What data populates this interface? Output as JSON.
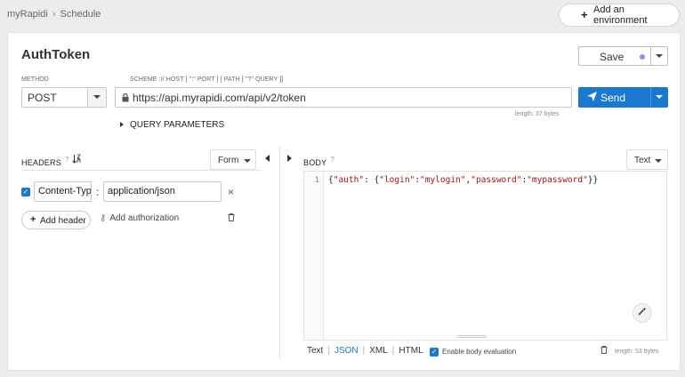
{
  "breadcrumb": {
    "root": "myRapidi",
    "separator": "›",
    "current": "Schedule"
  },
  "env_button": {
    "label": "Add an environment"
  },
  "request": {
    "title": "AuthToken",
    "save_label": "Save",
    "method_label": "METHOD",
    "method_value": "POST",
    "url_label": "SCHEME :// HOST [ \":\" PORT ] [ PATH [ \"?\" QUERY ]]",
    "url_value": "https://api.myrapidi.com/api/v2/token",
    "url_length": "length: 37 bytes",
    "send_label": "Send",
    "query_params_label": "QUERY PARAMETERS"
  },
  "headers": {
    "label": "HEADERS",
    "help": "?",
    "mode": "Form",
    "rows": [
      {
        "enabled": true,
        "name": "Content-Type",
        "value": "application/json"
      }
    ],
    "add_header_label": "Add header",
    "add_auth_label": "Add authorization"
  },
  "body": {
    "label": "BODY",
    "help": "?",
    "mode": "Text",
    "line_number": "1",
    "content": "{\"auth\": {\"login\":\"mylogin\",\"password\":\"mypassword\"}}",
    "formats": [
      "Text",
      "JSON",
      "XML",
      "HTML"
    ],
    "active_format": "JSON",
    "eval_label": "Enable body evaluation",
    "length": "length: 53 bytes"
  },
  "colors": {
    "accent": "#1b78cf",
    "save_dot": "#8e8ee8"
  },
  "icons": [
    "plus-icon",
    "lock-icon",
    "send-icon",
    "sort-icon",
    "key-icon",
    "trash-icon",
    "magic-wand-icon",
    "close-icon"
  ]
}
